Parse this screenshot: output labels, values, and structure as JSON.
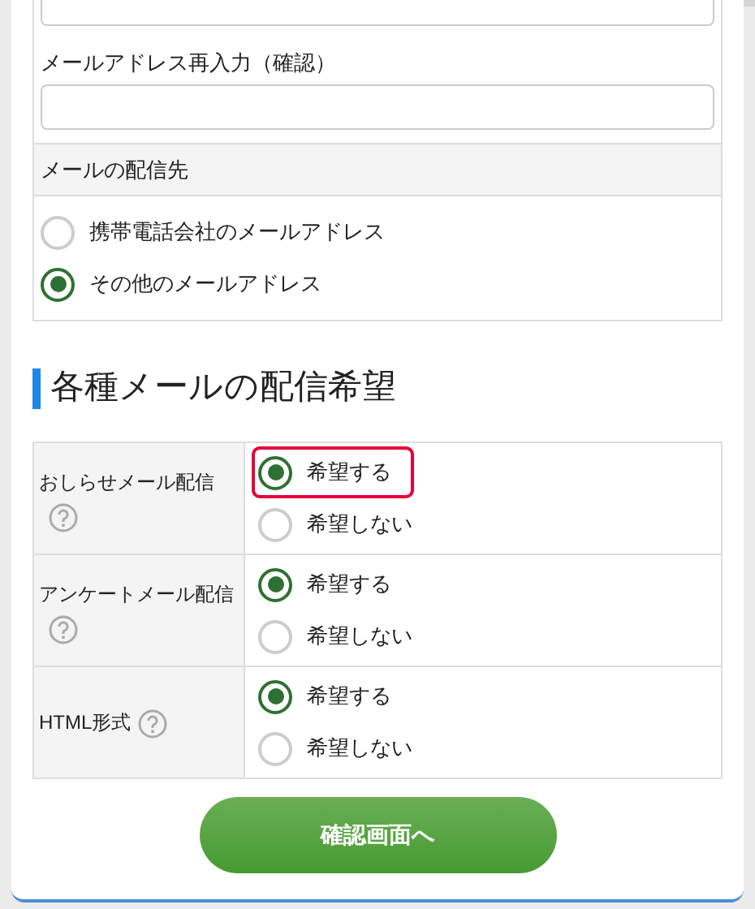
{
  "email_confirm": {
    "label": "メールアドレス再入力（確認）"
  },
  "delivery": {
    "header": "メールの配信先",
    "options": [
      {
        "label": "携帯電話会社のメールアドレス",
        "selected": false
      },
      {
        "label": "その他のメールアドレス",
        "selected": true
      }
    ]
  },
  "section_title": "各種メールの配信希望",
  "preferences": [
    {
      "label": "おしらせメール配信",
      "options": [
        {
          "label": "希望する",
          "selected": true,
          "highlighted": true
        },
        {
          "label": "希望しない",
          "selected": false,
          "highlighted": false
        }
      ]
    },
    {
      "label": "アンケートメール配信",
      "options": [
        {
          "label": "希望する",
          "selected": true,
          "highlighted": false
        },
        {
          "label": "希望しない",
          "selected": false,
          "highlighted": false
        }
      ]
    },
    {
      "label": "HTML形式",
      "options": [
        {
          "label": "希望する",
          "selected": true,
          "highlighted": false
        },
        {
          "label": "希望しない",
          "selected": false,
          "highlighted": false
        }
      ]
    }
  ],
  "submit_button": "確認画面へ"
}
